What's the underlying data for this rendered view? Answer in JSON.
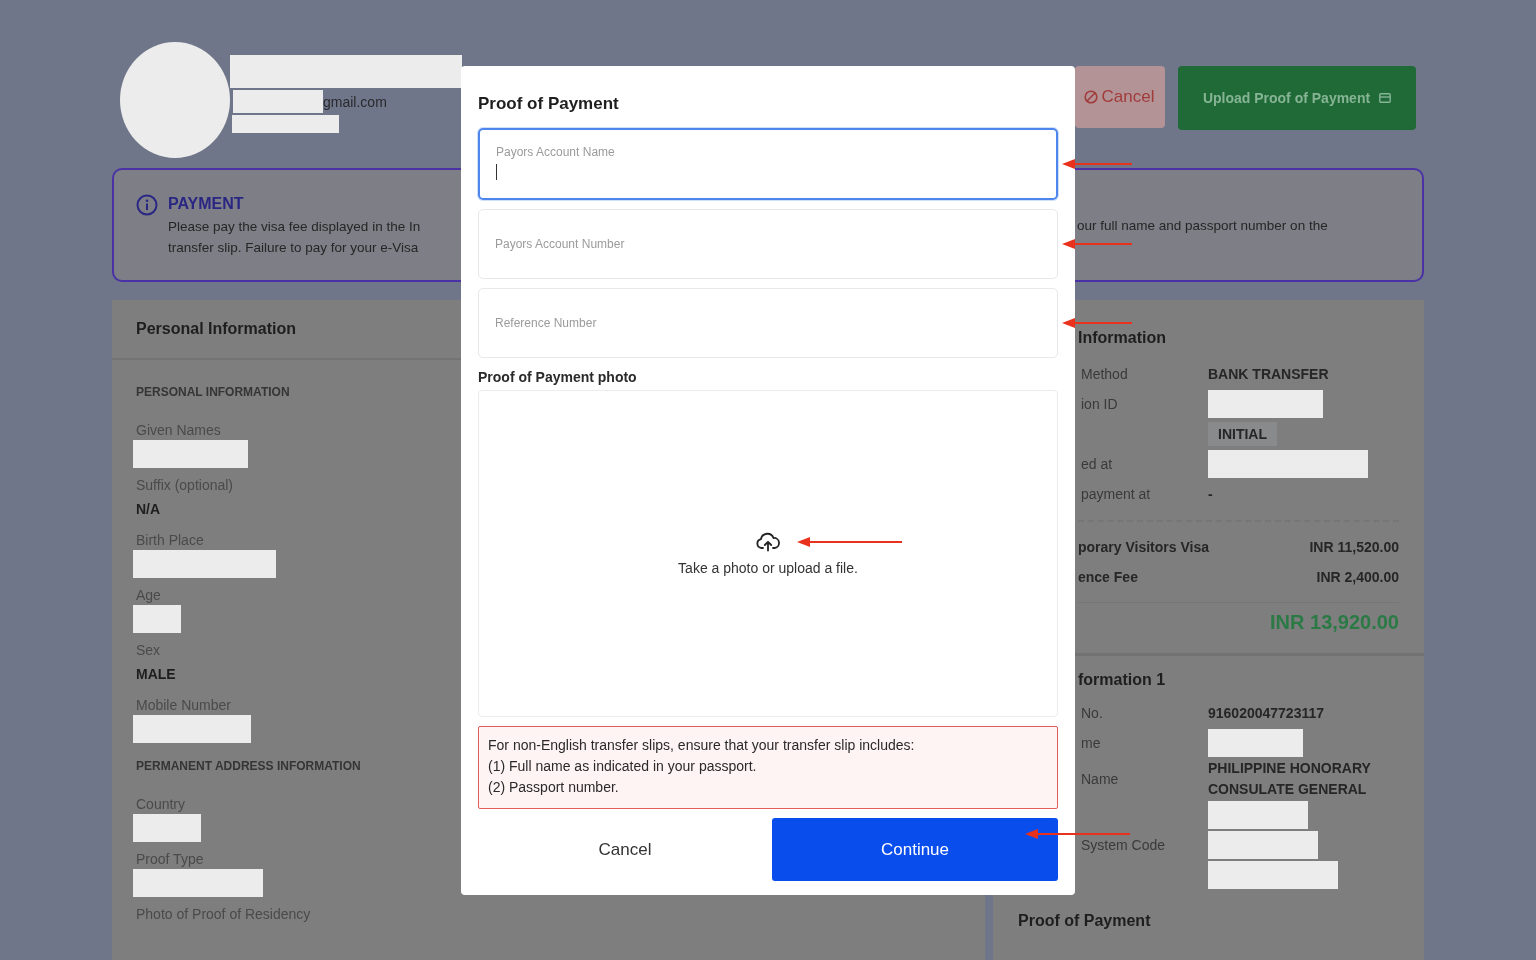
{
  "header": {
    "email_suffix": "gmail.com",
    "cancel_button": "Cancel",
    "upload_button": "Upload Proof of Payment"
  },
  "payment_notice": {
    "title": "PAYMENT",
    "left_lines": [
      "Please pay the visa fee displayed in the In",
      "transfer slip. Failure to pay for your e-Visa"
    ],
    "right_line": "our full name and passport number on the"
  },
  "personal_information": {
    "title": "Personal Information",
    "sections": [
      {
        "heading": "PERSONAL INFORMATION",
        "fields": [
          {
            "label": "Given Names",
            "kind": "redacted"
          },
          {
            "label": "Suffix (optional)",
            "kind": "text",
            "value": "N/A"
          },
          {
            "label": "Birth Place",
            "kind": "redacted"
          },
          {
            "label": "Age",
            "kind": "redacted"
          },
          {
            "label": "Sex",
            "kind": "text",
            "value": "MALE"
          },
          {
            "label": "Mobile Number",
            "kind": "redacted"
          }
        ]
      },
      {
        "heading": "PERMANENT ADDRESS INFORMATION",
        "fields": [
          {
            "label": "Country",
            "kind": "redacted"
          },
          {
            "label": "Proof Type",
            "kind": "redacted"
          },
          {
            "label": "Photo of Proof of Residency",
            "kind": "label"
          }
        ]
      }
    ]
  },
  "payment_information": {
    "title": "Information",
    "rows": [
      {
        "label": "Method",
        "kind": "text",
        "value": "BANK TRANSFER"
      },
      {
        "label": "ion ID",
        "kind": "redacted"
      },
      {
        "kind": "badge",
        "value": "INITIAL"
      },
      {
        "label": "ed at",
        "kind": "redacted"
      },
      {
        "label": "payment at",
        "kind": "text",
        "value": "-"
      }
    ],
    "fees": [
      {
        "label": "porary Visitors Visa",
        "amount": "INR 11,520.00"
      },
      {
        "label": "ence Fee",
        "amount": "INR 2,400.00"
      }
    ],
    "total": "INR 13,920.00"
  },
  "bank_information": {
    "title": "formation 1",
    "rows": [
      {
        "label": "No.",
        "kind": "text",
        "value": "916020047723117"
      },
      {
        "label": "me",
        "kind": "redacted"
      },
      {
        "label": "Name",
        "kind": "text",
        "value": "PHILIPPINE HONORARY CONSULATE GENERAL"
      },
      {
        "kind": "redacted"
      },
      {
        "label": "System Code",
        "kind": "redacted"
      },
      {
        "kind": "redacted"
      }
    ]
  },
  "proof_of_payment": {
    "title": "Proof of Payment"
  },
  "modal": {
    "title": "Proof of Payment",
    "fields": [
      {
        "label": "Payors Account Name",
        "focused": true
      },
      {
        "label": "Payors Account Number",
        "focused": false
      },
      {
        "label": "Reference Number",
        "focused": false
      }
    ],
    "photo_label": "Proof of Payment photo",
    "upload_hint": "Take a photo or upload a file.",
    "notice_lines": [
      "For non-English transfer slips, ensure that your transfer slip includes:",
      "(1) Full name as indicated in your passport.",
      "(2) Passport number."
    ],
    "cancel_button": "Cancel",
    "continue_button": "Continue"
  }
}
